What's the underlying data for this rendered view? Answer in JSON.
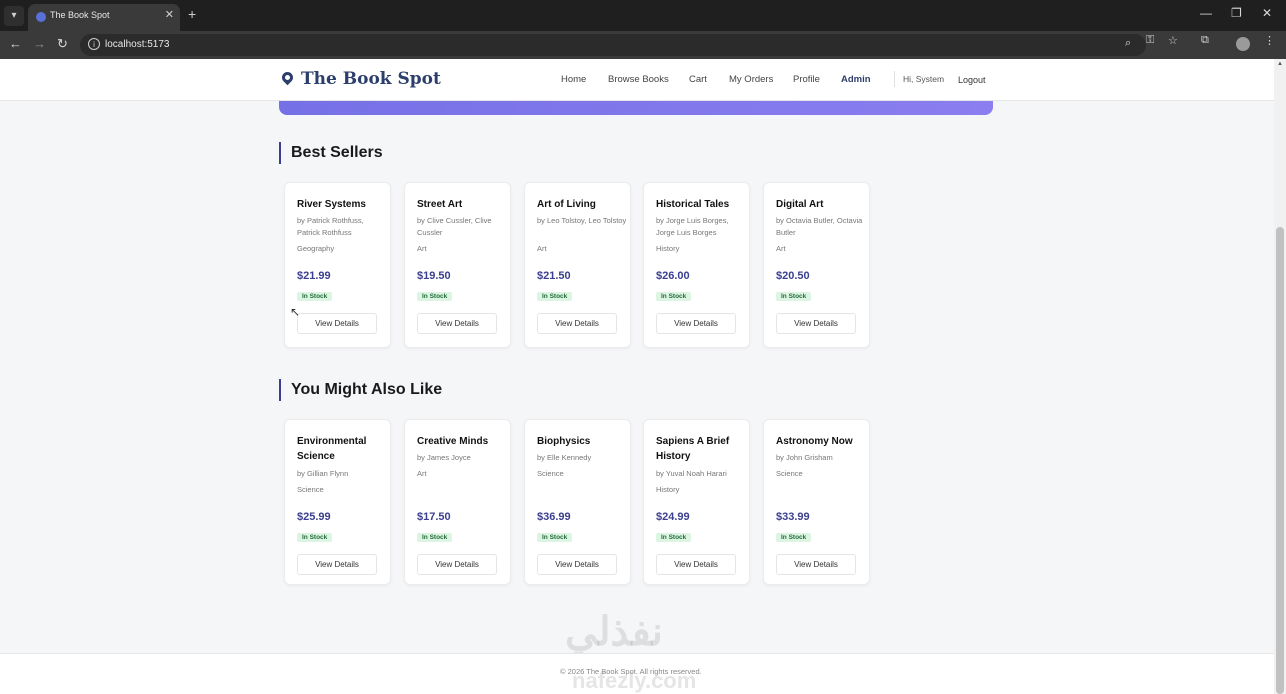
{
  "browser": {
    "tab_title": "The Book Spot",
    "url": "localhost:5173",
    "window_controls": [
      "minimize-icon",
      "restore-icon",
      "close-icon"
    ]
  },
  "header": {
    "logo": "The Book Spot",
    "nav": [
      "Home",
      "Browse Books",
      "Cart",
      "My Orders",
      "Profile",
      "Admin"
    ],
    "greeting": "Hi, System",
    "logout": "Logout"
  },
  "sections": [
    {
      "title": "Best Sellers",
      "books": [
        {
          "title": "River Systems",
          "author": "by Patrick Rothfuss, Patrick Rothfuss",
          "genre": "Geography",
          "price": "$21.99",
          "stock": "In Stock",
          "button": "View Details"
        },
        {
          "title": "Street Art",
          "author": "by Clive Cussler, Clive Cussler",
          "genre": "Art",
          "price": "$19.50",
          "stock": "In Stock",
          "button": "View Details"
        },
        {
          "title": "Art of Living",
          "author": "by Leo Tolstoy, Leo Tolstoy",
          "genre": "Art",
          "price": "$21.50",
          "stock": "In Stock",
          "button": "View Details"
        },
        {
          "title": "Historical Tales",
          "author": "by Jorge Luis Borges, Jorge Luis Borges",
          "genre": "History",
          "price": "$26.00",
          "stock": "In Stock",
          "button": "View Details"
        },
        {
          "title": "Digital Art",
          "author": "by Octavia Butler, Octavia Butler",
          "genre": "Art",
          "price": "$20.50",
          "stock": "In Stock",
          "button": "View Details"
        }
      ]
    },
    {
      "title": "You Might Also Like",
      "books": [
        {
          "title": "Environmental Science",
          "author": "by Gillian Flynn",
          "genre": "Science",
          "price": "$25.99",
          "stock": "In Stock",
          "button": "View Details"
        },
        {
          "title": "Creative Minds",
          "author": "by James Joyce",
          "genre": "Art",
          "price": "$17.50",
          "stock": "In Stock",
          "button": "View Details"
        },
        {
          "title": "Biophysics",
          "author": "by Elle Kennedy",
          "genre": "Science",
          "price": "$36.99",
          "stock": "In Stock",
          "button": "View Details"
        },
        {
          "title": "Sapiens A Brief History",
          "author": "by Yuval Noah Harari",
          "genre": "History",
          "price": "$24.99",
          "stock": "In Stock",
          "button": "View Details"
        },
        {
          "title": "Astronomy Now",
          "author": "by John Grisham",
          "genre": "Science",
          "price": "$33.99",
          "stock": "In Stock",
          "button": "View Details"
        }
      ]
    }
  ],
  "footer": {
    "text": "© 2026 The Book Spot. All rights reserved."
  },
  "watermark": {
    "arabic": "نفذلي",
    "latin": "nafezly.com"
  },
  "colors": {
    "brand": "#2c3e6b",
    "price": "#3b3f8f",
    "hero": "#7670e6",
    "stock_bg": "#dcf5e2"
  }
}
